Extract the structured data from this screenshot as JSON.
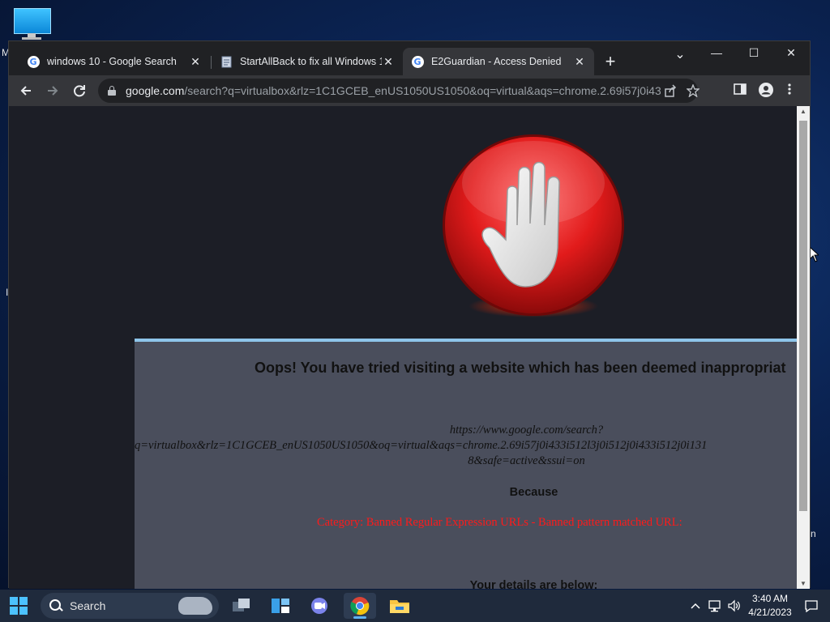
{
  "desktop": {
    "icon_name": "monitor-icon",
    "edge_text_left_top": "M",
    "edge_text_left_mid": "I",
    "edge_text_right": "n"
  },
  "browser": {
    "tabs": [
      {
        "label": "windows 10 - Google Search",
        "icon": "google-g-icon",
        "active": false
      },
      {
        "label": "StartAllBack to fix all Windows 1",
        "icon": "page-icon",
        "active": false
      },
      {
        "label": "E2Guardian - Access Denied",
        "icon": "google-g-icon",
        "active": true
      }
    ],
    "close_glyph": "✕",
    "new_tab_glyph": "+",
    "window_controls": {
      "tab_search": "⌄",
      "minimize": "—",
      "maximize": "☐",
      "close": "✕"
    },
    "url_host": "google.com",
    "url_path": "/search?q=virtualbox&rlz=1C1GCEB_enUS1050US1050&oq=virtual&aqs=chrome.2.69i57j0i43..."
  },
  "page": {
    "headline": "Oops! You have tried visiting a website which has been deemed inappropriat",
    "blocked_url_line1": "https://www.google.com/search?",
    "blocked_url_line2": "q=virtualbox&rlz=1C1GCEB_enUS1050US1050&oq=virtual&aqs=chrome.2.69i57j0i433i512l3j0i512j0i433i512j0i131",
    "blocked_url_line3": "8&safe=active&ssui=on",
    "because_label": "Because",
    "reason": "Category: Banned Regular Expression URLs - Banned pattern matched URL:",
    "details_label": "Your details are below:"
  },
  "taskbar": {
    "search_label": "Search",
    "time": "3:40 AM",
    "date": "4/21/2023"
  },
  "colors": {
    "reason_red": "#ff1a1a",
    "panel_bg": "#4a4e5c",
    "panel_border": "#8ec5ea",
    "stop_red": "#e21b1b"
  }
}
